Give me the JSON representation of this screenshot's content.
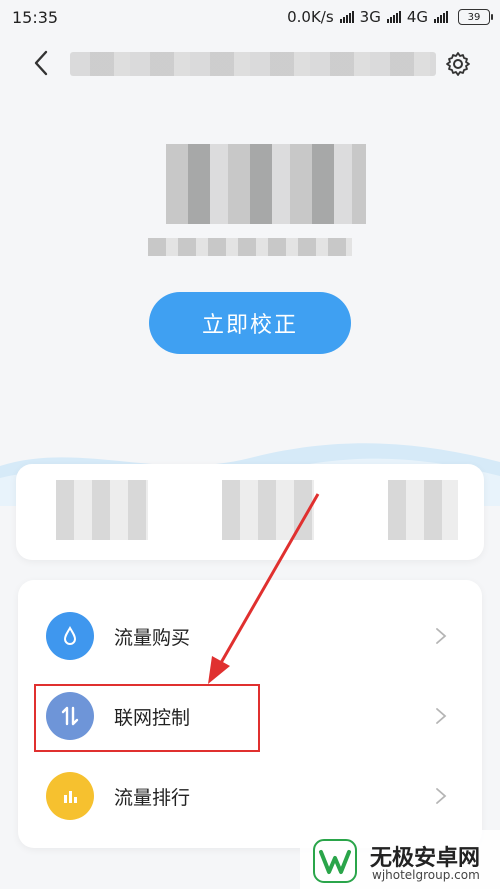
{
  "status_bar": {
    "time": "15:35",
    "speed": "0.0K/s",
    "net1": "3G",
    "net2": "4G",
    "battery": "39"
  },
  "primary_action": {
    "label": "立即校正"
  },
  "menu": {
    "items": [
      {
        "label": "流量购买",
        "icon": "drop-icon",
        "color": "#3f97ee"
      },
      {
        "label": "联网控制",
        "icon": "updown-arrows-icon",
        "color": "#6e95d8"
      },
      {
        "label": "流量排行",
        "icon": "bar-chart-icon",
        "color": "#f6c12f"
      }
    ]
  },
  "watermark": {
    "name": "无极安卓网",
    "url": "wjhotelgroup.com"
  },
  "colors": {
    "accent": "#3fa0f2",
    "annotation": "#e0302f"
  }
}
